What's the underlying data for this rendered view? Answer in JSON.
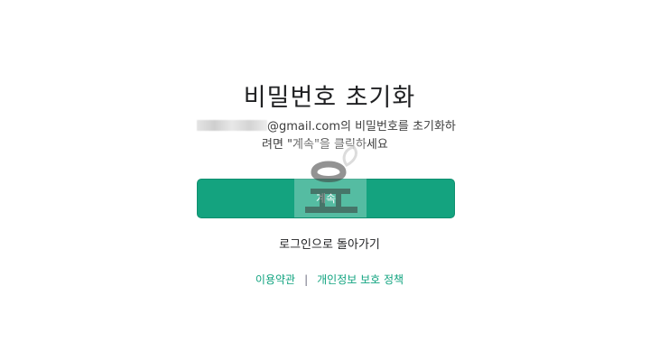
{
  "title": "비밀번호 초기화",
  "description": {
    "email_suffix": "@gmail.com의 비밀번호를 초기화하",
    "line2": "려면 \"계속\"을 클릭하세요"
  },
  "continue_button": {
    "label": "계속"
  },
  "back_link": "로그인으로 돌아가기",
  "footer": {
    "terms": "이용약관",
    "separator": "|",
    "privacy": "개인정보 보호 정책"
  },
  "colors": {
    "accent": "#10a37f",
    "button": "#14a37f",
    "text": "#202123"
  }
}
